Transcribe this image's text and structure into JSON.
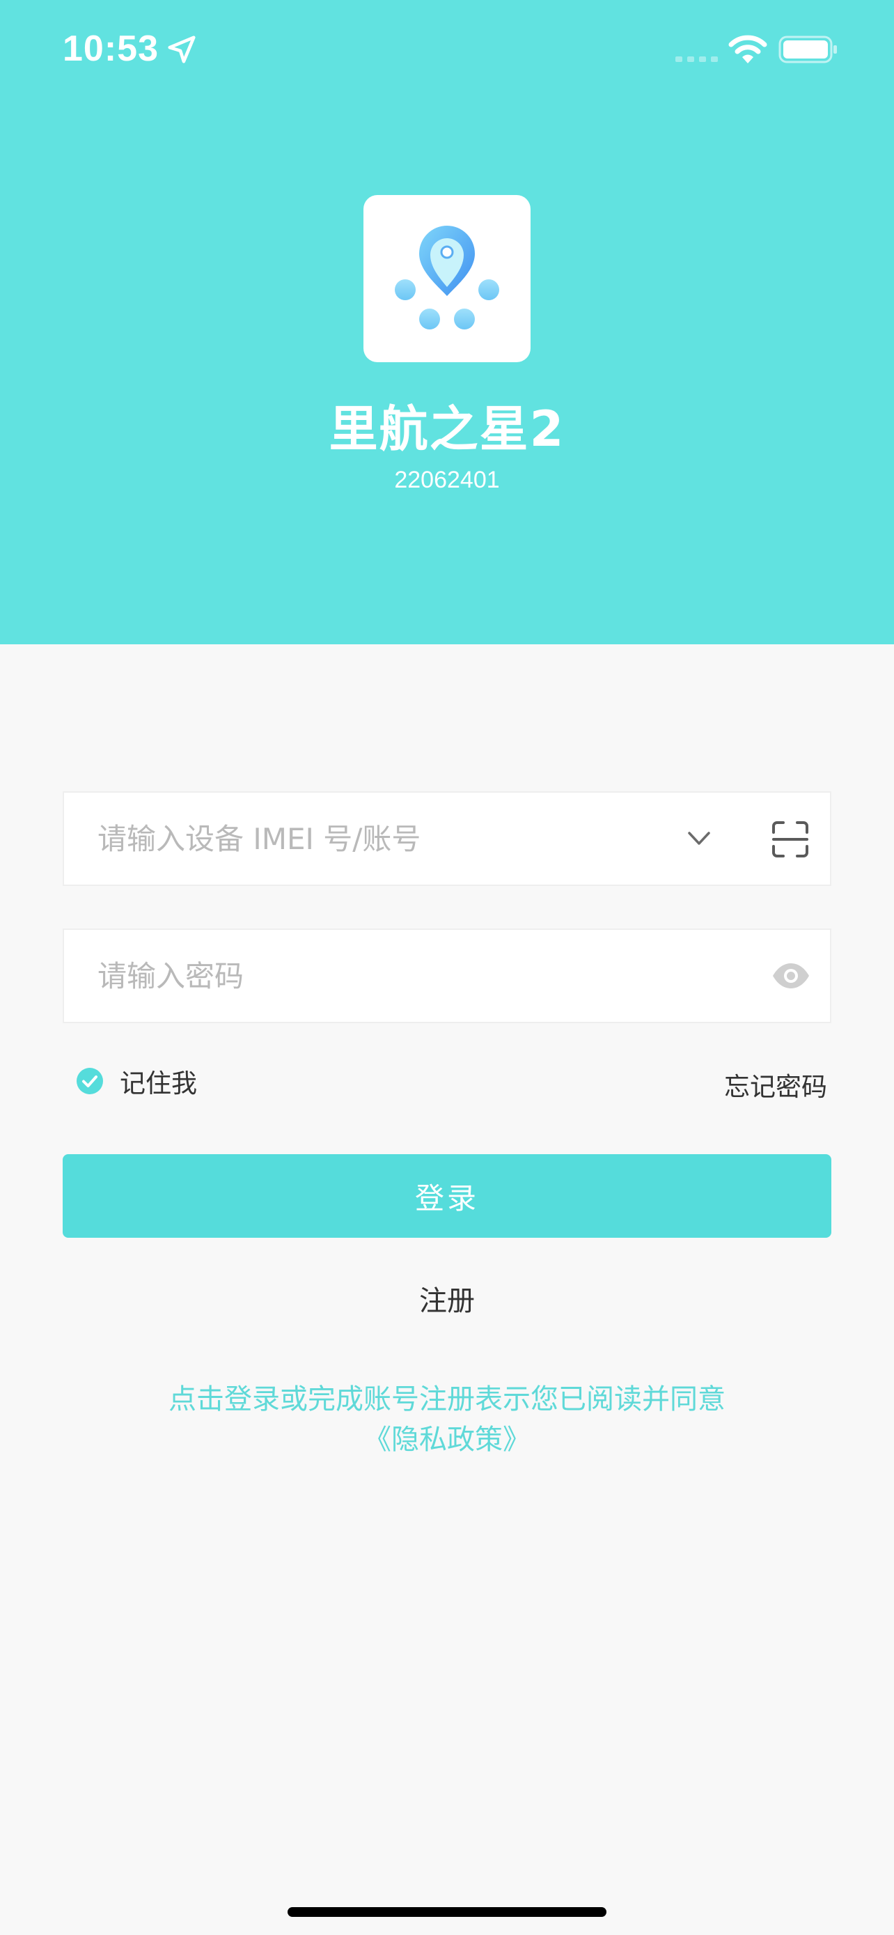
{
  "status_bar": {
    "time": "10:53"
  },
  "app": {
    "title": "里航之星2",
    "version": "22062401"
  },
  "login_form": {
    "account_placeholder": "请输入设备 IMEI 号/账号",
    "password_placeholder": "请输入密码",
    "remember_label": "记住我",
    "remember_checked": true,
    "forgot_label": "忘记密码",
    "login_label": "登录",
    "register_label": "注册"
  },
  "agreement": {
    "line1": "点击登录或完成账号注册表示您已阅读并同意",
    "line2": "《隐私政策》"
  },
  "colors": {
    "header_bg": "#61e2e0",
    "accent": "#55dcdb",
    "page_bg": "#f8f8f8",
    "link_text": "#5fd9d8"
  },
  "icons": {
    "location": "location-arrow-icon",
    "signal": "cellular-signal-icon",
    "wifi": "wifi-icon",
    "battery": "battery-icon",
    "dropdown": "chevron-down-icon",
    "scan": "scan-icon",
    "visibility": "eye-icon",
    "remember": "check-circle-icon"
  }
}
